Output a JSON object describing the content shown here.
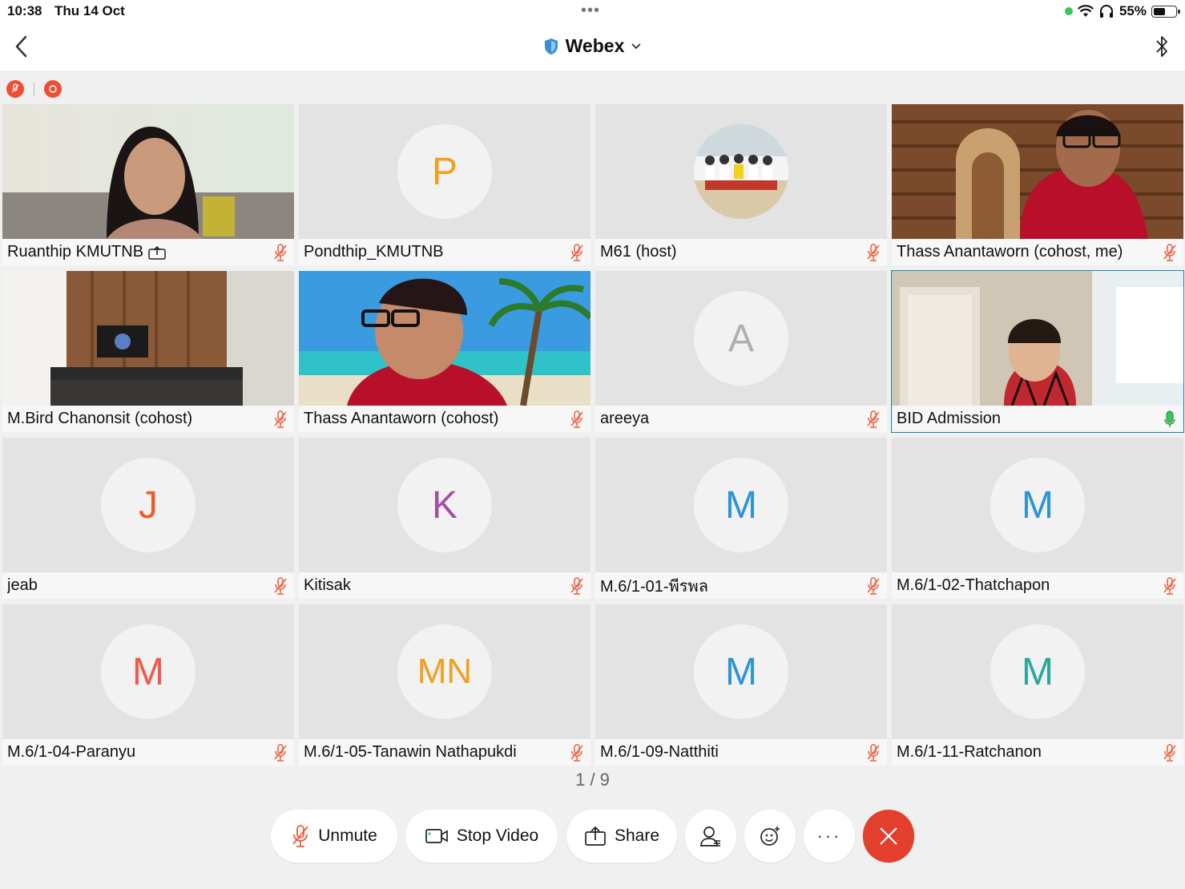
{
  "status_bar": {
    "time": "10:38",
    "date": "Thu 14 Oct",
    "battery": "55%",
    "battery_level": 0.55
  },
  "nav": {
    "title": "Webex"
  },
  "participants": [
    {
      "name": "Ruanthip KMUTNB",
      "type": "video",
      "sharing": true
    },
    {
      "name": "Pondthip_KMUTNB",
      "type": "avatar",
      "initials": "P",
      "color": "#f0a020"
    },
    {
      "name": "M61 (host)",
      "type": "photo"
    },
    {
      "name": "Thass Anantaworn (cohost, me)",
      "type": "video"
    },
    {
      "name": "M.Bird Chanonsit (cohost)",
      "type": "video"
    },
    {
      "name": "Thass Anantaworn (cohost)",
      "type": "video"
    },
    {
      "name": "areeya",
      "type": "avatar",
      "initials": "A",
      "color": "#b0b0b0"
    },
    {
      "name": "BID Admission",
      "type": "video",
      "active_speaker": true,
      "mic_on": true
    },
    {
      "name": "jeab",
      "type": "avatar",
      "initials": "J",
      "color": "#ef5a2a"
    },
    {
      "name": "Kitisak",
      "type": "avatar",
      "initials": "K",
      "color": "#a34fa8"
    },
    {
      "name": "M.6/1-01-พีรพล",
      "type": "avatar",
      "initials": "M",
      "color": "#2d94d6"
    },
    {
      "name": "M.6/1-02-Thatchapon",
      "type": "avatar",
      "initials": "M",
      "color": "#2d94d6"
    },
    {
      "name": "M.6/1-04-Paranyu",
      "type": "avatar",
      "initials": "M",
      "color": "#ef5a4a"
    },
    {
      "name": "M.6/1-05-Tanawin Nathapukdi",
      "type": "avatar",
      "initials": "MN",
      "color": "#f0a020"
    },
    {
      "name": "M.6/1-09-Natthiti",
      "type": "avatar",
      "initials": "M",
      "color": "#2d94d6"
    },
    {
      "name": "M.6/1-11-Ratchanon",
      "type": "avatar",
      "initials": "M",
      "color": "#2aa89a"
    }
  ],
  "pager": "1 / 9",
  "controls": {
    "unmute": "Unmute",
    "stop_video": "Stop Video",
    "share": "Share"
  },
  "colors": {
    "muted_mic": "#ef5a3a",
    "live_mic": "#34c759",
    "end_call": "#e23f2c",
    "active_border": "#1a8aa0"
  }
}
